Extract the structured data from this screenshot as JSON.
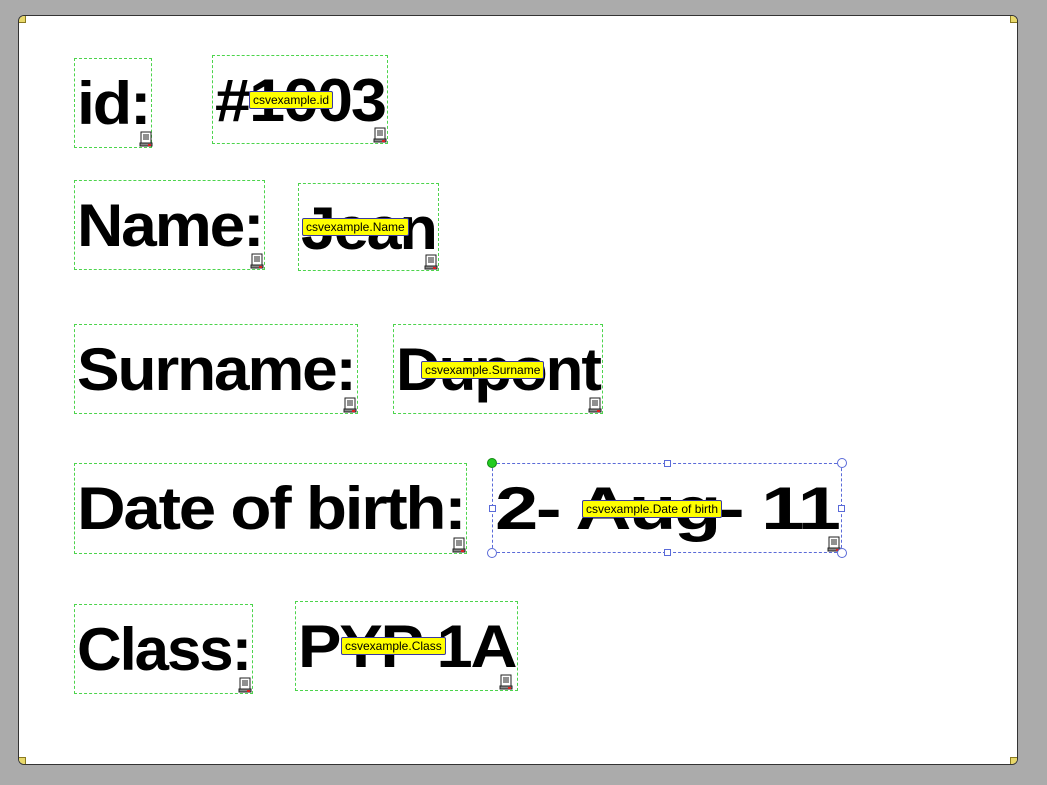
{
  "fields": [
    {
      "id": "id-label",
      "text": "id:",
      "tag": null
    },
    {
      "id": "id-value",
      "text": "#1003",
      "tag": "csvexample.id"
    },
    {
      "id": "name-label",
      "text": "Name:",
      "tag": null
    },
    {
      "id": "name-value",
      "text": "Jean",
      "tag": "csvexample.Name"
    },
    {
      "id": "surname-label",
      "text": "Surname:",
      "tag": null
    },
    {
      "id": "surname-value",
      "text": "Dupont",
      "tag": "csvexample.Surname"
    },
    {
      "id": "dob-label",
      "text": "Date of birth:",
      "tag": null
    },
    {
      "id": "dob-value",
      "text": "2- Aug- 11",
      "tag": "csvexample.Date of birth"
    },
    {
      "id": "class-label",
      "text": "Class:",
      "tag": null
    },
    {
      "id": "class-value",
      "text": "PYP 1A",
      "tag": "csvexample.Class"
    }
  ],
  "colors": {
    "tag_background": "#ffff00",
    "field_border": "#4cd44c",
    "selection_border": "#5a6ad8"
  },
  "icons": {
    "field_corner": "database-icon"
  }
}
